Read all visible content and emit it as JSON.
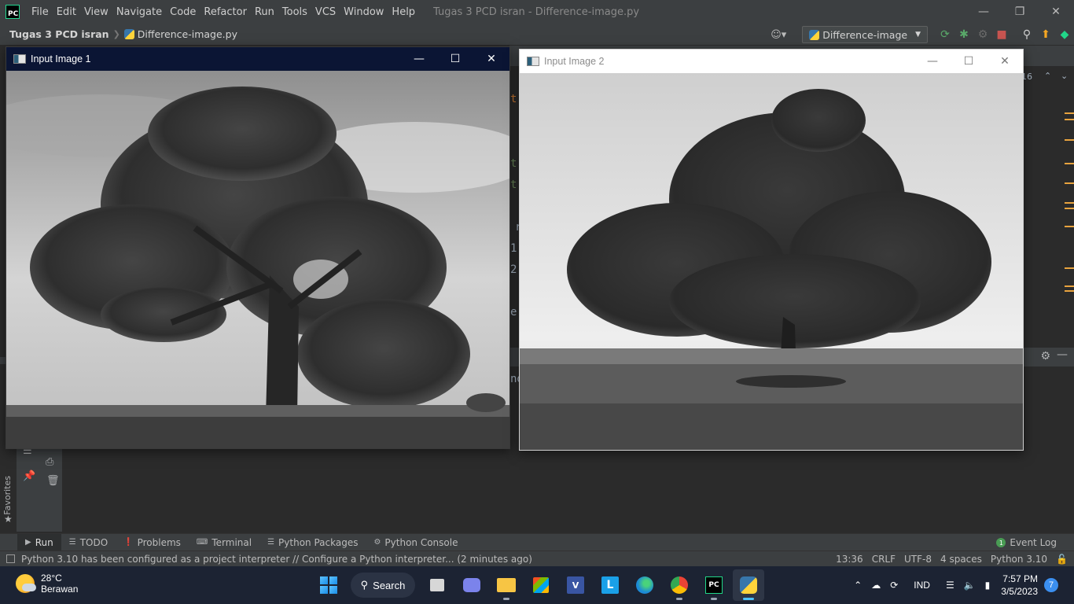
{
  "app": {
    "logo_text": "PC",
    "window_title": "Tugas 3 PCD isran - Difference-image.py",
    "menu": [
      "File",
      "Edit",
      "View",
      "Navigate",
      "Code",
      "Refactor",
      "Run",
      "Tools",
      "VCS",
      "Window",
      "Help"
    ]
  },
  "navbar": {
    "project": "Tugas 3 PCD isran",
    "file": "Difference-image.py",
    "run_config": "Difference-image"
  },
  "editor": {
    "fragments": [
      "t",
      "t",
      "t",
      "r",
      "1",
      "2",
      "e",
      "nd"
    ],
    "scroll_indicator": "16"
  },
  "cv_windows": [
    {
      "title": "Input Image 1"
    },
    {
      "title": "Input Image 2"
    }
  ],
  "side": {
    "favorites_label": "Favorites"
  },
  "tool_tabs": [
    {
      "label": "Run",
      "icon": "run-icon"
    },
    {
      "label": "TODO",
      "icon": "todo-icon"
    },
    {
      "label": "Problems",
      "icon": "problems-icon"
    },
    {
      "label": "Terminal",
      "icon": "terminal-icon"
    },
    {
      "label": "Python Packages",
      "icon": "packages-icon"
    },
    {
      "label": "Python Console",
      "icon": "console-icon"
    }
  ],
  "event_log": "Event Log",
  "status": {
    "message": "Python 3.10 has been configured as a project interpreter // Configure a Python interpreter... (2 minutes ago)",
    "position": "13:36",
    "line_sep": "CRLF",
    "encoding": "UTF-8",
    "indent": "4 spaces",
    "interpreter": "Python 3.10"
  },
  "taskbar": {
    "temperature": "28°C",
    "weather": "Berawan",
    "search_label": "Search",
    "language": "IND",
    "time": "7:57 PM",
    "date": "3/5/2023",
    "notifications": "7"
  },
  "colors": {
    "ide_bg": "#2b2b2b",
    "ide_panel": "#3c3f41",
    "cv_active_title": "#0b1534",
    "taskbar": "#1c2333"
  }
}
